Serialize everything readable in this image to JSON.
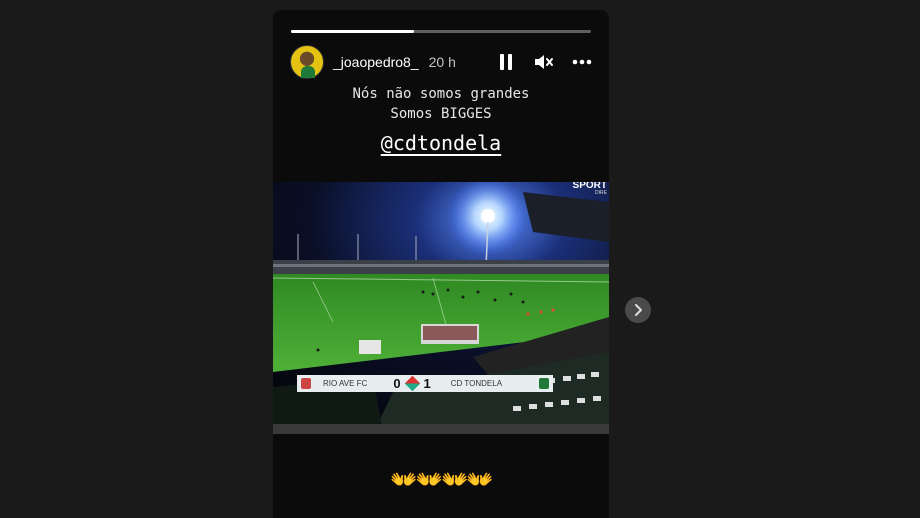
{
  "story": {
    "progress": 0.41,
    "username": "_joaopedro8_",
    "time": "20 h",
    "caption_line1": "Nós não somos grandes",
    "caption_line2": "Somos BIGGES",
    "mention": "@cdtondela",
    "emoji": "👐👐👐👐"
  },
  "scoreboard": {
    "home_team": "RIO AVE FC",
    "home_score": "0",
    "away_score": "1",
    "away_team": "CD TONDELA"
  },
  "broadcaster": {
    "name": "SPORT",
    "sub": "DIRE"
  },
  "icons": {
    "pause": "pause-icon",
    "mute": "muted-speaker-icon",
    "more": "more-dots-icon",
    "next": "chevron-right-icon"
  },
  "colors": {
    "pitch": "#3e9b2b",
    "scoreboard_bg": "#e8eef0",
    "accent_green": "#1f7a3a"
  }
}
